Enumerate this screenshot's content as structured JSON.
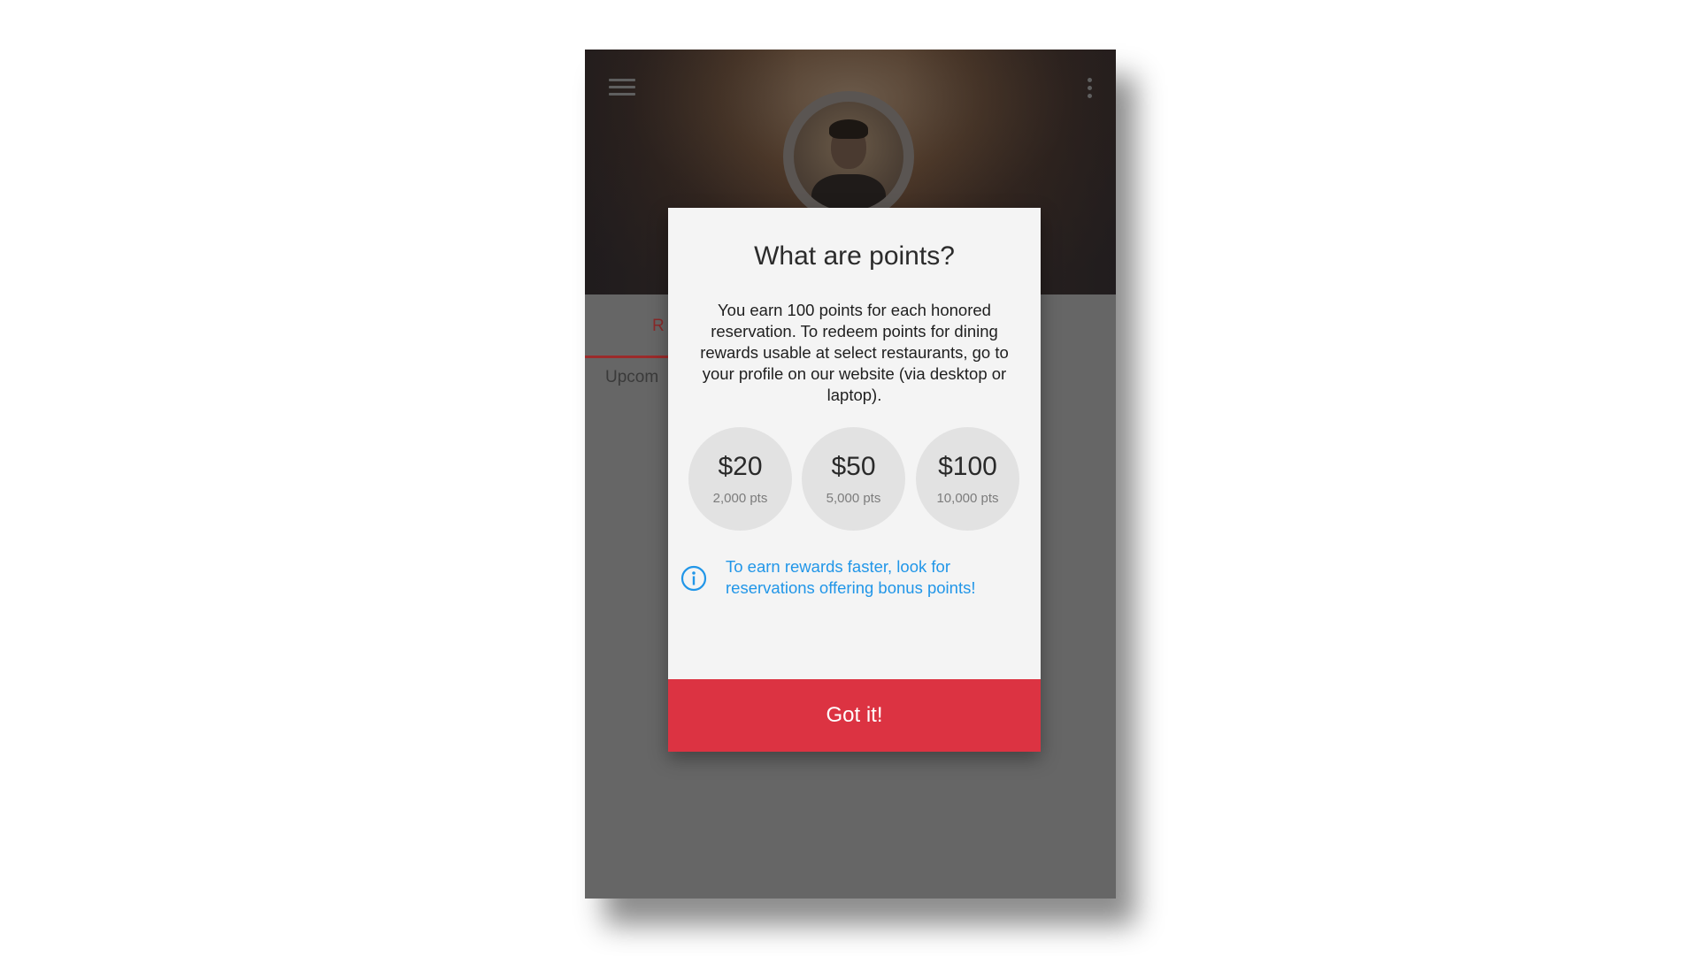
{
  "background_tab": {
    "active_tab_label_visible": "R",
    "section_label_visible": "Upcom"
  },
  "dialog": {
    "title": "What are points?",
    "body": "You earn 100 points for each honored reservation. To redeem points for dining rewards usable at select restaurants, go to your profile on our website (via desktop or laptop).",
    "tiers": [
      {
        "amount": "$20",
        "points": "2,000 pts"
      },
      {
        "amount": "$50",
        "points": "5,000 pts"
      },
      {
        "amount": "$100",
        "points": "10,000 pts"
      }
    ],
    "tip": "To earn rewards faster, look for reservations offering bonus points!",
    "button_label": "Got it!"
  },
  "icons": {
    "menu": "hamburger-menu-icon",
    "more": "more-vertical-icon",
    "info": "info-circle-icon"
  },
  "colors": {
    "accent_button": "#dc3342",
    "tip_text": "#2196e8",
    "tab_active": "#9c2b2b"
  }
}
